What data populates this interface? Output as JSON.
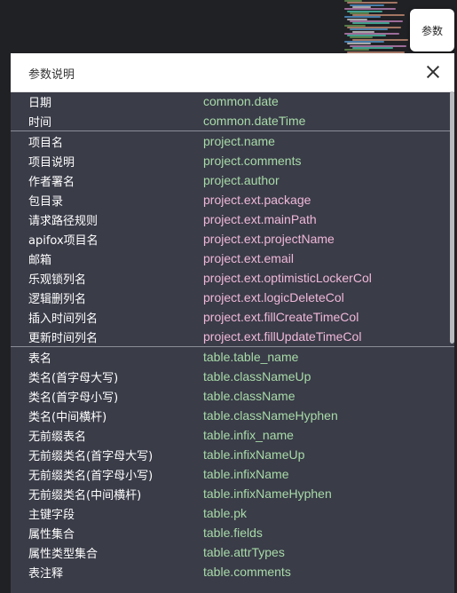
{
  "button": {
    "label": "参数"
  },
  "dialog": {
    "title": "参数说明",
    "sections": [
      {
        "rows": [
          {
            "label": "日期",
            "value": "common.date",
            "color": "green"
          },
          {
            "label": "时间",
            "value": "common.dateTime",
            "color": "green"
          }
        ]
      },
      {
        "rows": [
          {
            "label": "项目名",
            "value": "project.name",
            "color": "green"
          },
          {
            "label": "项目说明",
            "value": "project.comments",
            "color": "green"
          },
          {
            "label": "作者署名",
            "value": "project.author",
            "color": "green"
          },
          {
            "label": "包目录",
            "value": "project.ext.package",
            "color": "pink"
          },
          {
            "label": "请求路径规则",
            "value": "project.ext.mainPath",
            "color": "pink"
          },
          {
            "label": "apifox项目名",
            "value": "project.ext.projectName",
            "color": "pink"
          },
          {
            "label": "邮箱",
            "value": "project.ext.email",
            "color": "pink"
          },
          {
            "label": "乐观锁列名",
            "value": "project.ext.optimisticLockerCol",
            "color": "pink"
          },
          {
            "label": "逻辑删列名",
            "value": "project.ext.logicDeleteCol",
            "color": "pink"
          },
          {
            "label": "插入时间列名",
            "value": "project.ext.fillCreateTimeCol",
            "color": "pink"
          },
          {
            "label": "更新时间列名",
            "value": "project.ext.fillUpdateTimeCol",
            "color": "pink"
          }
        ]
      },
      {
        "rows": [
          {
            "label": "表名",
            "value": "table.table_name",
            "color": "green"
          },
          {
            "label": "类名(首字母大写)",
            "value": "table.classNameUp",
            "color": "green"
          },
          {
            "label": "类名(首字母小写)",
            "value": "table.className",
            "color": "green"
          },
          {
            "label": "类名(中间横杆)",
            "value": "table.classNameHyphen",
            "color": "green"
          },
          {
            "label": "无前缀表名",
            "value": "table.infix_name",
            "color": "green"
          },
          {
            "label": "无前缀类名(首字母大写)",
            "value": "table.infixNameUp",
            "color": "green"
          },
          {
            "label": "无前缀类名(首字母小写)",
            "value": "table.infixName",
            "color": "green"
          },
          {
            "label": "无前缀类名(中间横杆)",
            "value": "table.infixNameHyphen",
            "color": "green"
          },
          {
            "label": "主键字段",
            "value": "table.pk",
            "color": "green"
          },
          {
            "label": "属性集合",
            "value": "table.fields",
            "color": "green"
          },
          {
            "label": "属性类型集合",
            "value": "table.attrTypes",
            "color": "green"
          },
          {
            "label": "表注释",
            "value": "table.comments",
            "color": "green"
          }
        ]
      }
    ]
  },
  "colors": {
    "green": "#a8dba8",
    "pink": "#f0b8da",
    "dialog_bg": "#3a3c48",
    "page_bg": "#202124"
  },
  "icons": {
    "close": "close-icon"
  }
}
